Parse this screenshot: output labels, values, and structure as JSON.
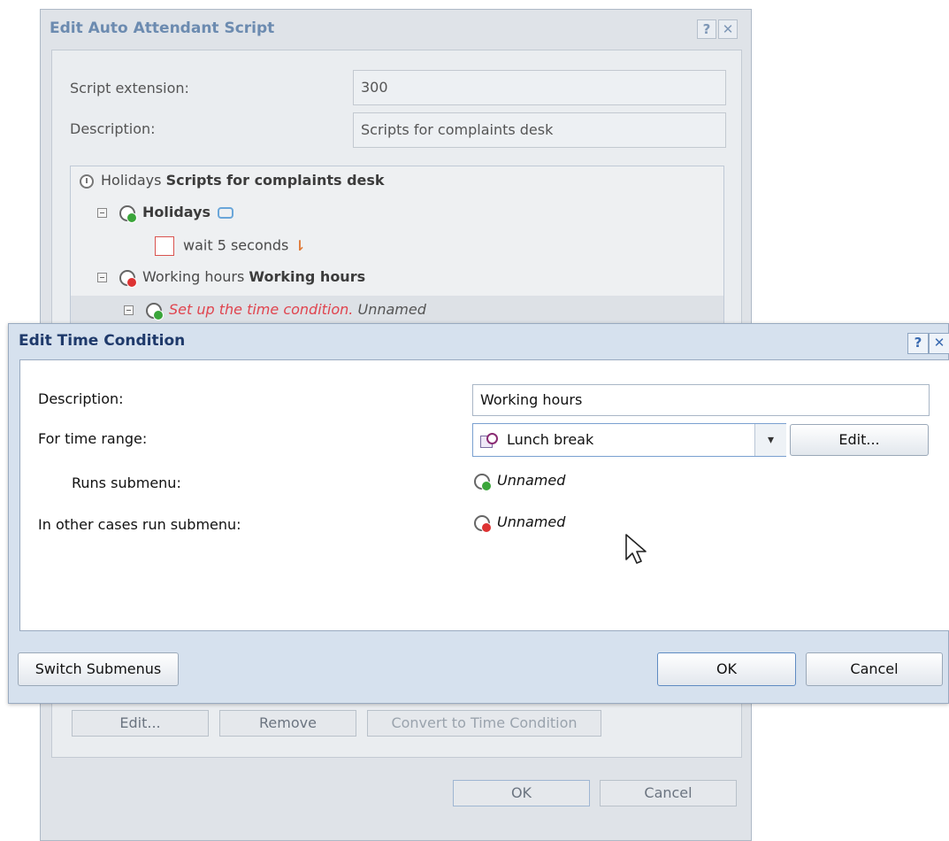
{
  "background_dialog": {
    "title": "Edit Auto Attendant Script",
    "help_label": "?",
    "close_label": "✕",
    "fields": {
      "script_extension_label": "Script extension:",
      "script_extension_value": "300",
      "description_label": "Description:",
      "description_value": "Scripts for complaints desk"
    },
    "tree": {
      "root": {
        "prefix": "Holidays",
        "name": "Scripts for complaints desk",
        "icon": "clock-icon"
      },
      "holidays": {
        "name": "Holidays",
        "icon": "time-condition-true-icon"
      },
      "wait_action": {
        "label": "wait 5 seconds",
        "icon": "phone-transfer-icon"
      },
      "working_hours": {
        "prefix": "Working hours",
        "name": "Working hours",
        "icon": "time-condition-false-icon"
      },
      "setup_condition": {
        "warning": "Set up the time condition.",
        "name": "Unnamed",
        "icon": "time-condition-true-icon"
      }
    },
    "buttons": {
      "edit": "Edit...",
      "remove": "Remove",
      "convert": "Convert to Time Condition",
      "ok": "OK",
      "cancel": "Cancel"
    }
  },
  "dialog": {
    "title": "Edit Time Condition",
    "help_label": "?",
    "close_label": "✕",
    "description_label": "Description:",
    "description_value": "Working hours",
    "time_range_label": "For time range:",
    "time_range_value": "Lunch break",
    "time_range_icon": "time-range-icon",
    "time_range_edit": "Edit...",
    "runs_submenu_label": "Runs submenu:",
    "runs_submenu_value": "Unnamed",
    "other_cases_label": "In other cases run submenu:",
    "other_cases_value": "Unnamed",
    "switch_button": "Switch Submenus",
    "ok_button": "OK",
    "cancel_button": "Cancel"
  },
  "colors": {
    "accent": "#1f3a6b",
    "warning_text": "#e0444e",
    "dialog_chrome": "#d6e1ee"
  }
}
